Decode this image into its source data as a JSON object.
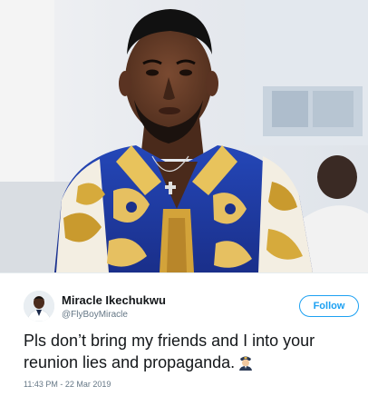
{
  "photo": {
    "description_icon": "portrait-photo"
  },
  "tweet": {
    "display_name": "Miracle Ikechukwu",
    "handle": "@FlyBoyMiracle",
    "follow_label": "Follow",
    "text": "Pls don’t bring my friends and I into your reunion lies and propaganda.",
    "emoji": "pilot-emoji",
    "timestamp": "11:43 PM - 22 Mar 2019"
  },
  "colors": {
    "accent": "#1da1f2",
    "muted": "#657786",
    "text": "#14171a"
  }
}
